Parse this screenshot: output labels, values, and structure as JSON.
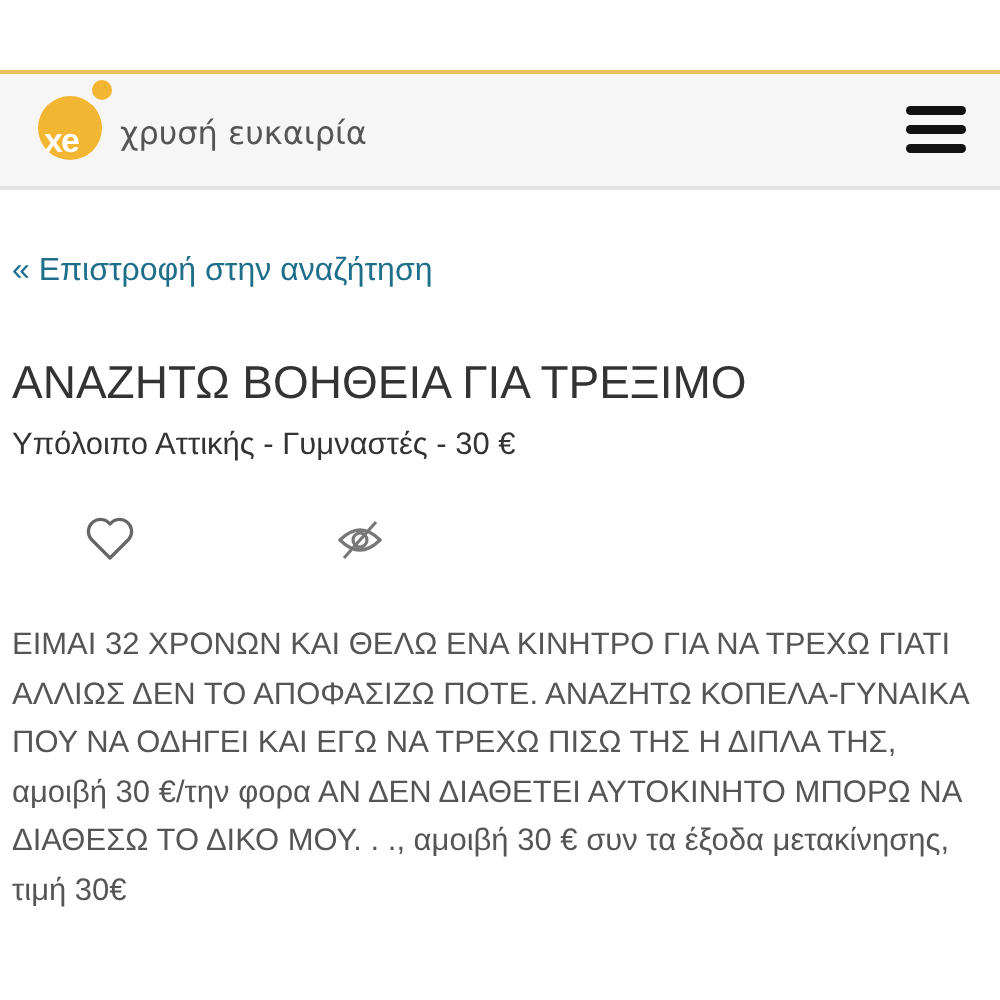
{
  "header": {
    "logo_mark": "xe",
    "logo_text": "χρυσή ευκαιρία"
  },
  "back_link": "« Επιστροφή στην αναζήτηση",
  "title": "ΑΝΑΖΗΤΩ ΒΟΗΘΕΙΑ ΓΙΑ ΤΡΕΞΙΜΟ",
  "subtitle": "Υπόλοιπο Αττικής - Γυμναστές - 30 €",
  "description": "ΕΙΜΑΙ 32 ΧΡΟΝΩΝ ΚΑΙ ΘΕΛΩ ΕΝΑ ΚΙΝΗΤΡΟ ΓΙΑ ΝΑ ΤΡΕΧΩ ΓΙΑΤΙ ΑΛΛΙΩΣ ΔΕΝ ΤΟ ΑΠΟΦΑΣΙΖΩ ΠΟΤΕ. ΑΝΑΖΗΤΩ ΚΟΠΕΛΑ-ΓΥΝΑΙΚΑ ΠΟΥ ΝΑ ΟΔΗΓΕΙ ΚΑΙ ΕΓΩ ΝΑ ΤΡΕΧΩ ΠΙΣΩ ΤΗΣ Η ΔΙΠΛΑ ΤΗΣ, αμοιβή 30 €/την φορα ΑΝ ΔΕΝ ΔΙΑΘΕΤΕΙ ΑΥΤΟΚΙΝΗΤΟ ΜΠΟΡΩ ΝΑ ΔΙΑΘΕΣΩ ΤΟ ΔΙΚΟ ΜΟΥ. . ., αμοιβή 30 € συν τα έξοδα μετακίνησης, τιμή 30€"
}
